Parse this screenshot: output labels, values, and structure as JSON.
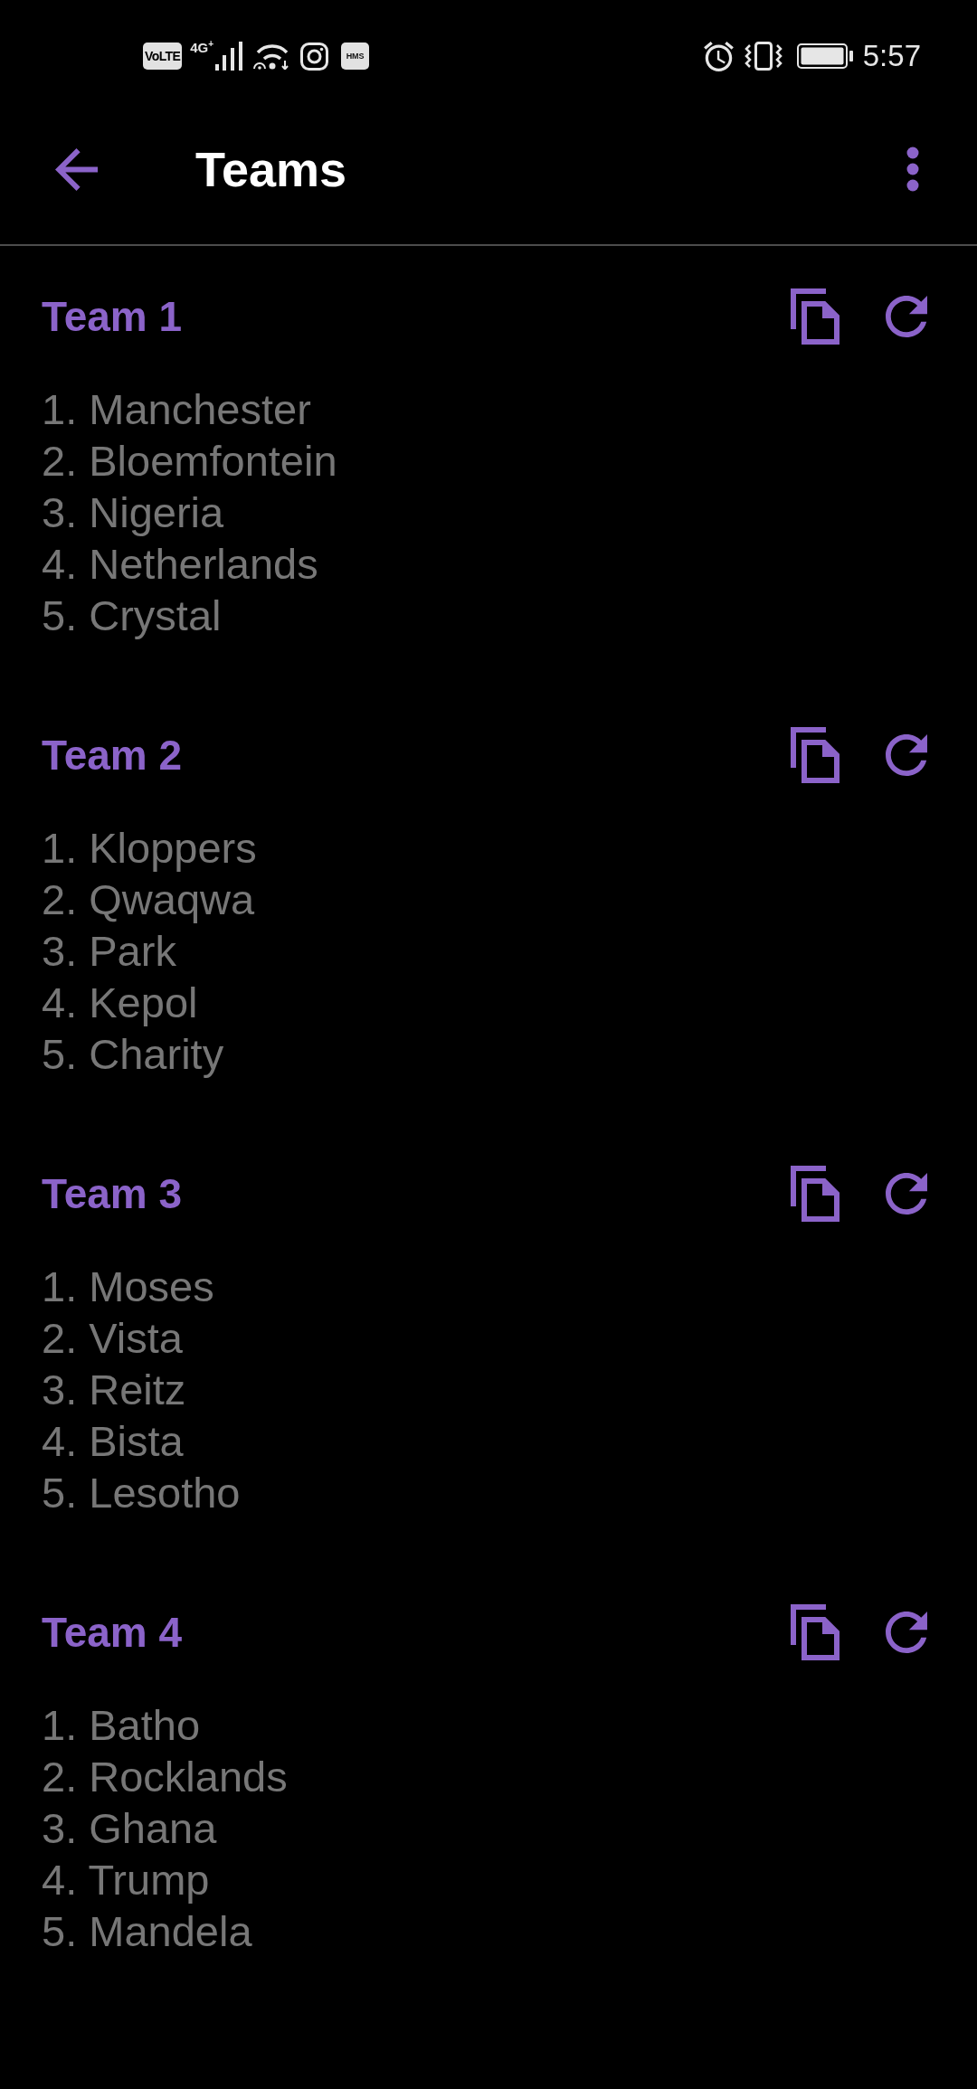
{
  "status_bar": {
    "volte": "VoLTE",
    "network": "4G$^{+}$",
    "hms": "HMS",
    "time": "5:57"
  },
  "app_bar": {
    "title": "Teams"
  },
  "teams": [
    {
      "title": "Team 1",
      "members": [
        "1. Manchester",
        "2. Bloemfontein",
        "3. Nigeria",
        "4. Netherlands",
        "5. Crystal"
      ]
    },
    {
      "title": "Team 2",
      "members": [
        "1. Kloppers",
        "2. Qwaqwa",
        "3. Park",
        "4. Kepol",
        "5. Charity"
      ]
    },
    {
      "title": "Team 3",
      "members": [
        "1. Moses",
        "2. Vista",
        "3. Reitz",
        "4. Bista",
        "5. Lesotho"
      ]
    },
    {
      "title": "Team 4",
      "members": [
        "1. Batho",
        "2. Rocklands",
        "3. Ghana",
        "4. Trump",
        "5. Mandela"
      ]
    }
  ]
}
